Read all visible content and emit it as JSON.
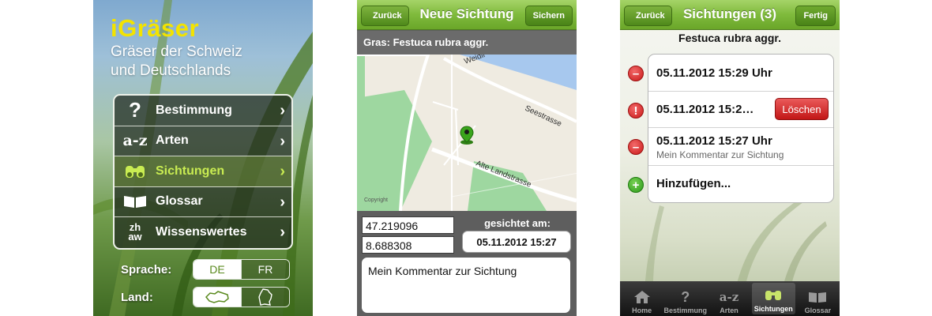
{
  "screen1": {
    "app_title": "iGräser",
    "subtitle_line1": "Gräser der Schweiz",
    "subtitle_line2": "und Deutschlands",
    "menu": [
      {
        "label": "Bestimmung",
        "icon": "question-icon",
        "glyph": "?"
      },
      {
        "label": "Arten",
        "icon": "az-icon",
        "glyph": "a-z"
      },
      {
        "label": "Sichtungen",
        "icon": "binoculars-icon",
        "glyph": "",
        "active": true
      },
      {
        "label": "Glossar",
        "icon": "book-icon",
        "glyph": ""
      },
      {
        "label": "Wissenswertes",
        "icon": "zhaw-icon",
        "glyph": "zh aw"
      }
    ],
    "language_label": "Sprache:",
    "language_options": [
      "DE",
      "FR"
    ],
    "language_selected": "DE",
    "country_label": "Land:",
    "country_options": [
      "CH",
      "DE"
    ],
    "country_selected": "CH"
  },
  "screen2": {
    "back_label": "Zurück",
    "title": "Neue Sichtung",
    "save_label": "Sichern",
    "species_line": "Gras: Festuca rubra aggr.",
    "map_labels": {
      "street1": "Seestrasse",
      "street2": "Alte Landstrasse",
      "street3": "Weidli",
      "copyright": "Copyright"
    },
    "latitude": "47.219096",
    "longitude": "8.688308",
    "seen_label": "gesichtet am:",
    "seen_value": "05.11.2012 15:27",
    "comment": "Mein Kommentar zur Sichtung"
  },
  "screen3": {
    "back_label": "Zurück",
    "title": "Sichtungen (3)",
    "done_label": "Fertig",
    "species": "Festuca rubra aggr.",
    "rows": [
      {
        "date": "05.11.2012 15:29 Uhr",
        "comment": ""
      },
      {
        "date": "05.11.2012 15:2…",
        "comment": ""
      },
      {
        "date": "05.11.2012 15:27 Uhr",
        "comment": "Mein Kommentar zur Sichtung"
      }
    ],
    "delete_label": "Löschen",
    "add_label": "Hinzufügen...",
    "tabs": [
      {
        "label": "Home",
        "icon": "home-icon"
      },
      {
        "label": "Bestimmung",
        "icon": "question-icon"
      },
      {
        "label": "Arten",
        "icon": "az-icon"
      },
      {
        "label": "Sichtungen",
        "icon": "binoculars-icon",
        "active": true
      },
      {
        "label": "Glossar",
        "icon": "book-icon"
      }
    ]
  },
  "colors": {
    "accent_yellow": "#f3e300",
    "nav_green": "#7fba3c",
    "active_green": "#c9ec52",
    "delete_red": "#c21616"
  }
}
